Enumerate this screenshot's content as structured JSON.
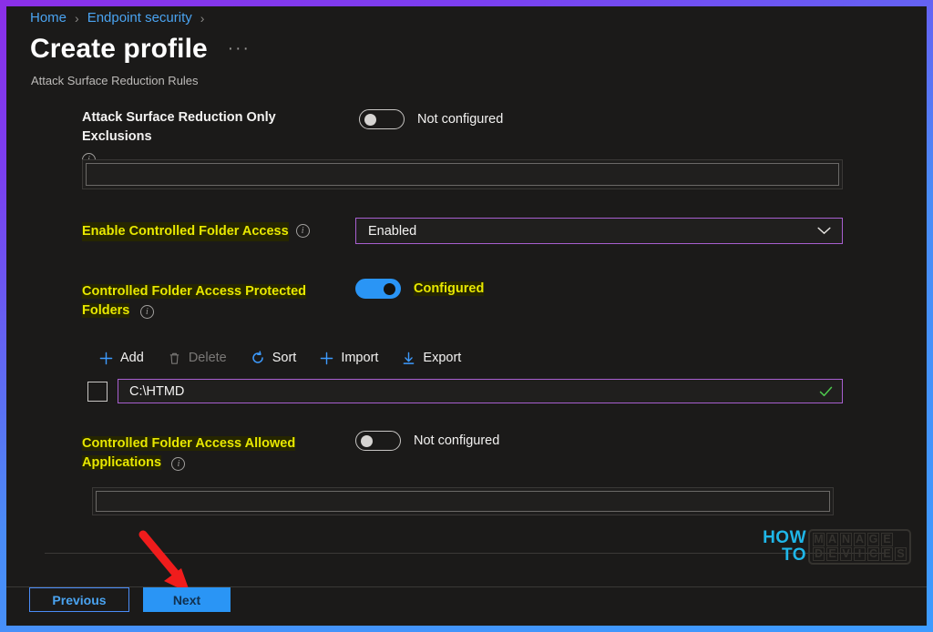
{
  "breadcrumb": {
    "items": [
      {
        "label": "Home"
      },
      {
        "label": "Endpoint security"
      }
    ],
    "separator": "›"
  },
  "header": {
    "title": "Create profile",
    "overflow_menu": "···",
    "subtitle": "Attack Surface Reduction Rules"
  },
  "settings": [
    {
      "label": "Attack Surface Reduction Only Exclusions",
      "info_icon": "info-icon",
      "toggle_state": "off",
      "toggle_text": "Not configured",
      "highlighted": false
    },
    {
      "label": "Enable Controlled Folder Access",
      "info_icon": "info-icon",
      "control": "dropdown",
      "value": "Enabled",
      "highlighted": true
    },
    {
      "label": "Controlled Folder Access Protected Folders",
      "info_icon": "info-icon",
      "toggle_state": "on",
      "toggle_text": "Configured",
      "highlighted": true
    },
    {
      "label": "Controlled Folder Access Allowed Applications",
      "info_icon": "info-icon",
      "toggle_state": "off",
      "toggle_text": "Not configured",
      "highlighted": true
    }
  ],
  "command_bar": {
    "commands": [
      {
        "label": "Add",
        "icon": "plus-icon",
        "disabled": false
      },
      {
        "label": "Delete",
        "icon": "trash-icon",
        "disabled": true
      },
      {
        "label": "Sort",
        "icon": "refresh-icon",
        "disabled": false
      },
      {
        "label": "Import",
        "icon": "plus-icon",
        "disabled": false
      },
      {
        "label": "Export",
        "icon": "download-icon",
        "disabled": false
      }
    ]
  },
  "protected_folders_list": {
    "rows": [
      {
        "checked": false,
        "value": "C:\\HTMD",
        "validation": "valid"
      }
    ]
  },
  "watermark": {
    "how": "HOW",
    "to": "TO",
    "manage": "MANAGE",
    "devices": "DEVICES"
  },
  "footer": {
    "previous_label": "Previous",
    "next_label": "Next"
  },
  "colors": {
    "accent_blue": "#2a95f5",
    "link_blue": "#4aa3f0",
    "highlight_yellow": "#e8e800",
    "purple_border": "#a85fd0",
    "valid_green": "#4ec94e",
    "arrow_red": "#f01c1c"
  }
}
